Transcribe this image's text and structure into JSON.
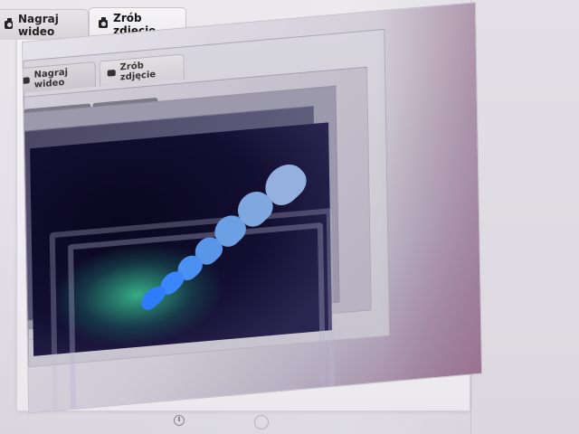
{
  "tabs": {
    "video_label": "Nagraj wideo",
    "photo_label": "Zrób zdjęcie"
  },
  "preview": {
    "inner_tabs": {
      "video_label": "Nagraj wideo",
      "photo_label": "Zrób zdjęcie"
    }
  },
  "controls": {
    "timer_icon": "timer-icon",
    "shutter_icon": "shutter-icon"
  },
  "colors": {
    "tab_active_bg": "#f5f4f6",
    "tab_bg": "#d6d3d9",
    "page_bg": "#e4e1e8"
  }
}
